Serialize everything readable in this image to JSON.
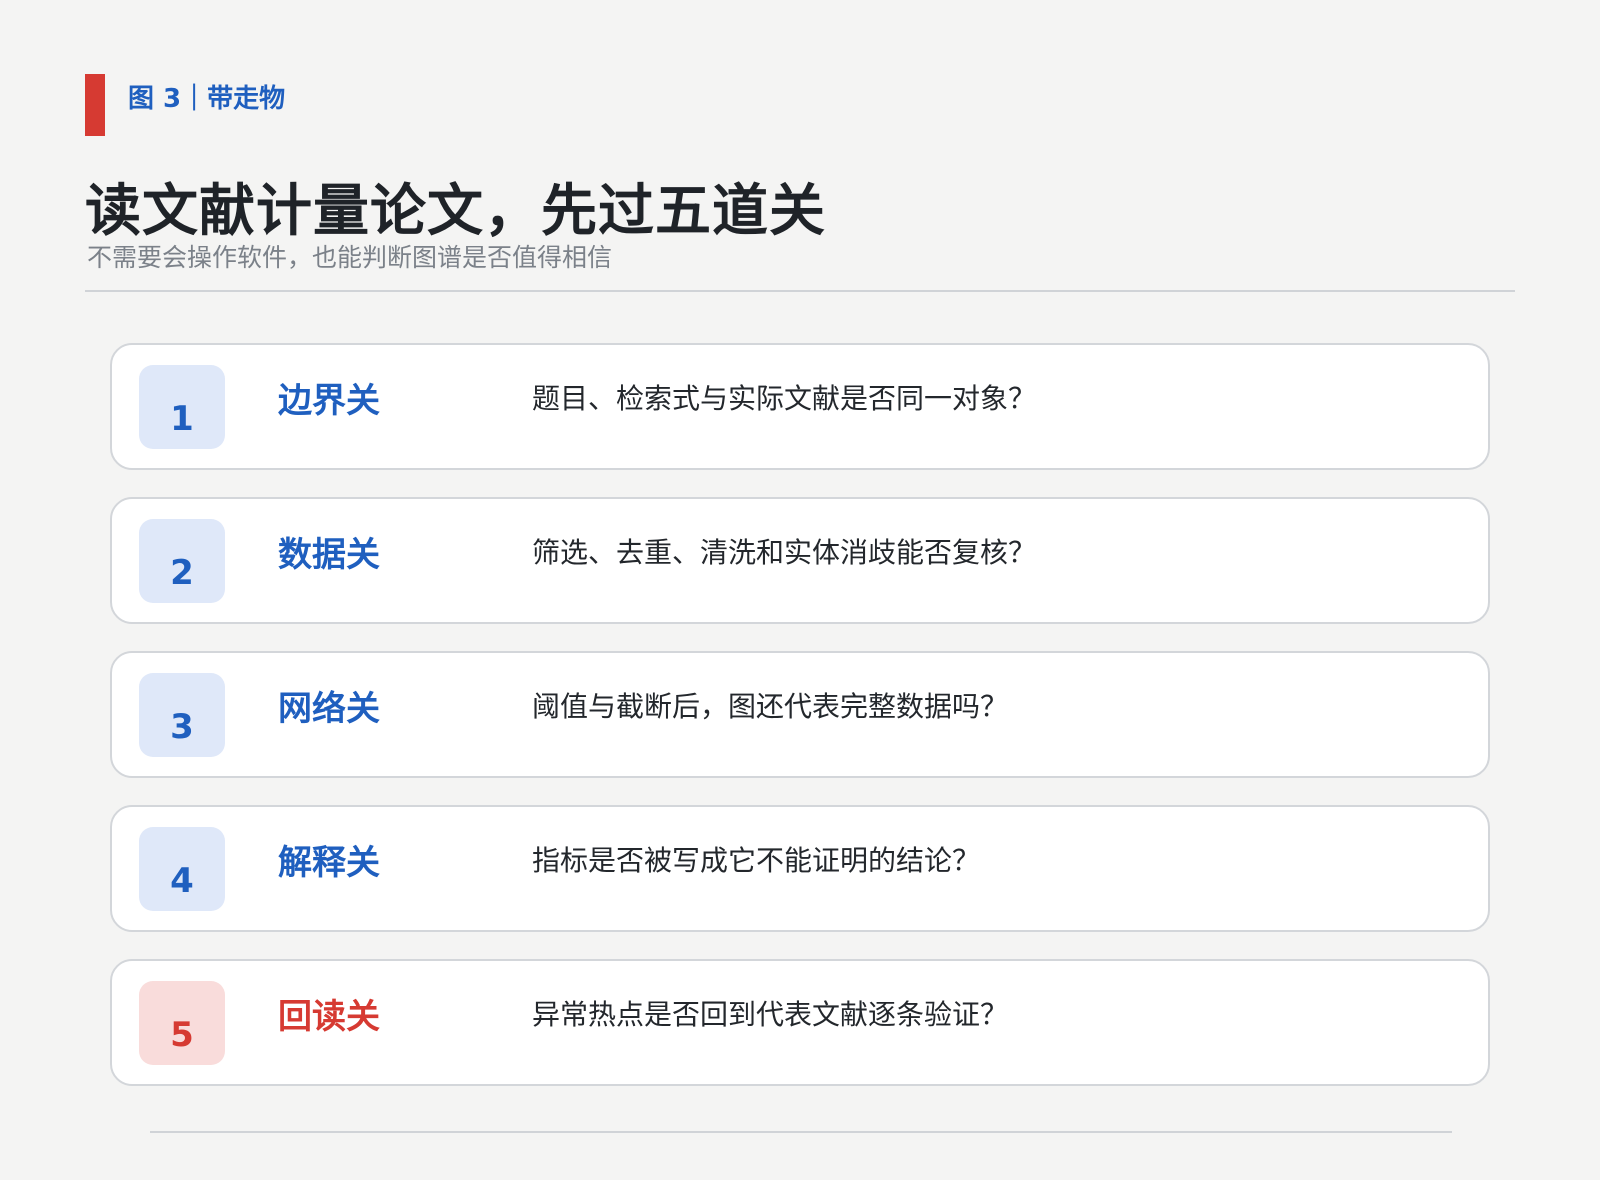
{
  "header": {
    "figure_label": "图 3｜带走物",
    "title": "读文献计量论文，先过五道关",
    "subtitle": "不需要会操作软件，也能判断图谱是否值得相信"
  },
  "colors": {
    "accent_red": "#d63a32",
    "accent_blue": "#1f5fbf",
    "badge_blue_bg": "#dfe8f9",
    "badge_red_bg": "#f9dcdb"
  },
  "gates": [
    {
      "number": "1",
      "name": "边界关",
      "question": "题目、检索式与实际文献是否同一对象？"
    },
    {
      "number": "2",
      "name": "数据关",
      "question": "筛选、去重、清洗和实体消歧能否复核？"
    },
    {
      "number": "3",
      "name": "网络关",
      "question": "阈值与截断后，图还代表完整数据吗？"
    },
    {
      "number": "4",
      "name": "解释关",
      "question": "指标是否被写成它不能证明的结论？"
    },
    {
      "number": "5",
      "name": "回读关",
      "question": "异常热点是否回到代表文献逐条验证？",
      "highlight": true
    }
  ]
}
